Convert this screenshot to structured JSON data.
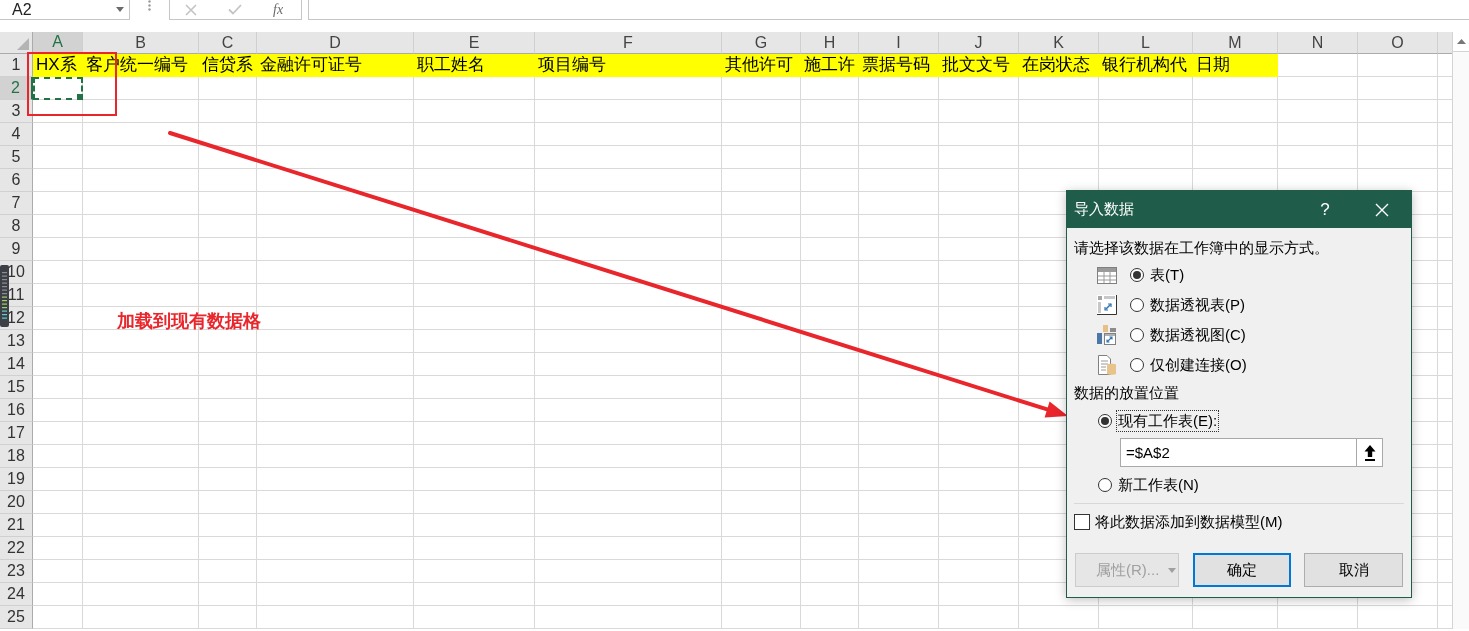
{
  "formula_bar": {
    "name_box": "A2",
    "function_label": "fx"
  },
  "columns": [
    {
      "label": "A",
      "selected": true
    },
    {
      "label": "B",
      "selected": false
    },
    {
      "label": "C",
      "selected": false
    },
    {
      "label": "D",
      "selected": false
    },
    {
      "label": "E",
      "selected": false
    },
    {
      "label": "F",
      "selected": false
    },
    {
      "label": "G",
      "selected": false
    },
    {
      "label": "H",
      "selected": false
    },
    {
      "label": "I",
      "selected": false
    },
    {
      "label": "J",
      "selected": false
    },
    {
      "label": "K",
      "selected": false
    },
    {
      "label": "L",
      "selected": false
    },
    {
      "label": "M",
      "selected": false
    },
    {
      "label": "N",
      "selected": false
    },
    {
      "label": "O",
      "selected": false
    }
  ],
  "rows": [
    {
      "number": "1",
      "selected": false,
      "highlighted": true,
      "cells": [
        "HX系",
        "客户统一编号",
        "信贷系",
        "金融许可证号",
        "职工姓名",
        "项目编号",
        "其他许可",
        "施工许",
        "票据号码",
        "批文文号",
        "在岗状态",
        "银行机构代",
        "日期"
      ]
    },
    {
      "number": "2",
      "selected": true,
      "highlighted": false
    },
    {
      "number": "3",
      "selected": false,
      "highlighted": false
    },
    {
      "number": "4",
      "selected": false,
      "highlighted": false
    },
    {
      "number": "5",
      "selected": false,
      "highlighted": false
    },
    {
      "number": "6",
      "selected": false,
      "highlighted": false
    },
    {
      "number": "7",
      "selected": false,
      "highlighted": false
    },
    {
      "number": "8",
      "selected": false,
      "highlighted": false
    },
    {
      "number": "9",
      "selected": false,
      "highlighted": false
    },
    {
      "number": "10",
      "selected": false,
      "highlighted": false
    },
    {
      "number": "11",
      "selected": false,
      "highlighted": false
    },
    {
      "number": "12",
      "selected": false,
      "highlighted": false
    },
    {
      "number": "13",
      "selected": false,
      "highlighted": false
    },
    {
      "number": "14",
      "selected": false,
      "highlighted": false
    },
    {
      "number": "15",
      "selected": false,
      "highlighted": false
    },
    {
      "number": "16",
      "selected": false,
      "highlighted": false
    },
    {
      "number": "17",
      "selected": false,
      "highlighted": false
    },
    {
      "number": "18",
      "selected": false,
      "highlighted": false
    },
    {
      "number": "19",
      "selected": false,
      "highlighted": false
    },
    {
      "number": "20",
      "selected": false,
      "highlighted": false
    },
    {
      "number": "21",
      "selected": false,
      "highlighted": false
    },
    {
      "number": "22",
      "selected": false,
      "highlighted": false
    },
    {
      "number": "23",
      "selected": false,
      "highlighted": false
    },
    {
      "number": "24",
      "selected": false,
      "highlighted": false
    },
    {
      "number": "25",
      "selected": false,
      "highlighted": false
    }
  ],
  "annotation": {
    "text": "加载到现有数据格"
  },
  "dialog": {
    "title": "导入数据",
    "help_label": "?",
    "prompt": "请选择该数据在工作簿中的显示方式。",
    "view_options": [
      {
        "kind": "table",
        "label": "表(T)",
        "selected": true
      },
      {
        "kind": "pivot_table",
        "label": "数据透视表(P)",
        "selected": false
      },
      {
        "kind": "pivot_chart",
        "label": "数据透视图(C)",
        "selected": false
      },
      {
        "kind": "connection",
        "label": "仅创建连接(O)",
        "selected": false
      }
    ],
    "placement_heading": "数据的放置位置",
    "placement_options": [
      {
        "label": "现有工作表(E):",
        "selected": true
      },
      {
        "label": "新工作表(N)",
        "selected": false
      }
    ],
    "location": {
      "value": "=$A$2"
    },
    "data_model": {
      "label": "将此数据添加到数据模型(M)",
      "checked": false
    },
    "buttons": [
      {
        "kind": "dropdown",
        "label": "属性(R)...",
        "disabled": true
      },
      {
        "kind": "default",
        "label": "确定",
        "disabled": false
      },
      {
        "kind": "plain",
        "label": "取消",
        "disabled": false
      }
    ]
  }
}
